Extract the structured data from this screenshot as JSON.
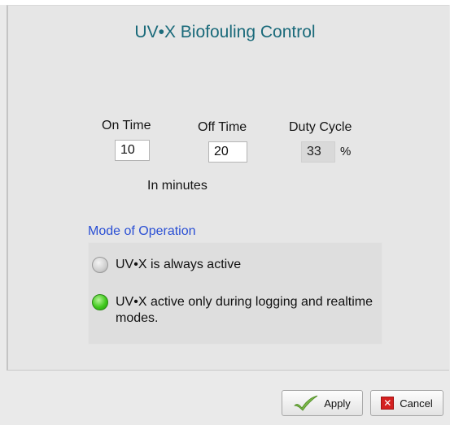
{
  "dialog": {
    "title": "UV•X Biofouling Control"
  },
  "timing": {
    "on_time_label": "On Time",
    "on_time_value": "10",
    "off_time_label": "Off Time",
    "off_time_value": "20",
    "duty_cycle_label": "Duty Cycle",
    "duty_cycle_value": "33",
    "duty_cycle_unit": "%",
    "units_note": "In minutes"
  },
  "mode": {
    "heading": "Mode of Operation",
    "options": [
      {
        "label": "UV•X is always active",
        "selected": false
      },
      {
        "label": "UV•X active only during logging and realtime modes.",
        "selected": true
      }
    ]
  },
  "buttons": {
    "apply_label": "Apply",
    "apply_icon": "checkmark-icon",
    "cancel_label": "Cancel",
    "cancel_icon": "close-x-icon"
  },
  "colors": {
    "title": "#1a6a7a",
    "mode_heading": "#2a4fd4",
    "radio_selected": "#41c91e",
    "cancel_icon": "#d42020"
  }
}
